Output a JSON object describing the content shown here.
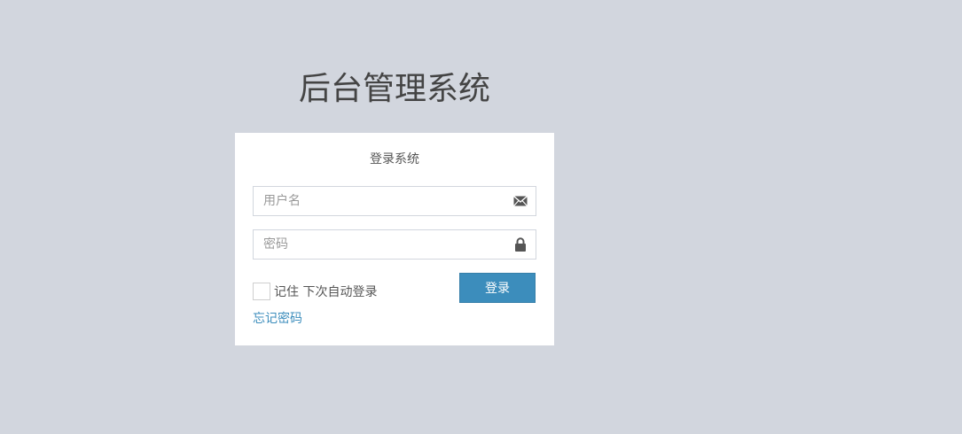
{
  "app": {
    "title": "后台管理系统"
  },
  "login": {
    "box_title": "登录系统",
    "username": {
      "value": "",
      "placeholder": "用户名",
      "icon": "envelope-icon"
    },
    "password": {
      "value": "",
      "placeholder": "密码",
      "icon": "lock-icon"
    },
    "remember_label": "记住 下次自动登录",
    "remember_checked": false,
    "submit_label": "登录",
    "forgot_label": "忘记密码"
  },
  "colors": {
    "background": "#d2d6de",
    "primary": "#3c8dbc",
    "panel": "#ffffff",
    "icon": "#555555"
  }
}
